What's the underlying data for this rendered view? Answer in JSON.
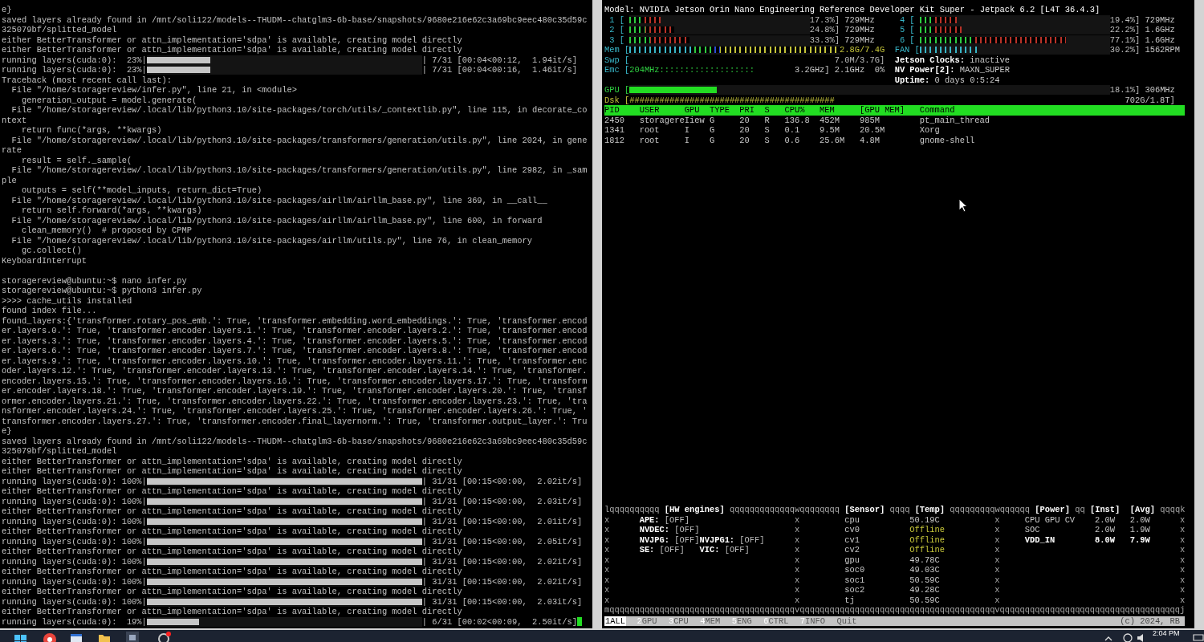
{
  "terminal": {
    "cursor": true,
    "lines": [
      {
        "kind": "text",
        "text": "e}"
      },
      {
        "kind": "text",
        "text": "saved layers already found in /mnt/soli122/models--THUDM--chatglm3-6b-base/snapshots/9680e216e62c3a69bc9eec480c35d59c"
      },
      {
        "kind": "text",
        "text": "325079bf/splitted_model"
      },
      {
        "kind": "text",
        "text": "either BetterTransformer or attn_implementation='sdpa' is available, creating model directly"
      },
      {
        "kind": "text",
        "text": "either BetterTransformer or attn_implementation='sdpa' is available, creating model directly"
      },
      {
        "kind": "progress",
        "prefix": "running layers(cuda:0):  23%|",
        "level": 0.23,
        "suffix": "| 7/31 [00:04<00:12,  1.94it/s]"
      },
      {
        "kind": "progress",
        "prefix": "running layers(cuda:0):  23%|",
        "level": 0.23,
        "suffix": "| 7/31 [00:04<00:16,  1.46it/s]"
      },
      {
        "kind": "text",
        "text": "Traceback (most recent call last):"
      },
      {
        "kind": "text",
        "text": "  File \"/home/storagereview/infer.py\", line 21, in <module>"
      },
      {
        "kind": "text",
        "text": "    generation_output = model.generate("
      },
      {
        "kind": "text",
        "text": "  File \"/home/storagereview/.local/lib/python3.10/site-packages/torch/utils/_contextlib.py\", line 115, in decorate_co"
      },
      {
        "kind": "text",
        "text": "ntext"
      },
      {
        "kind": "text",
        "text": "    return func(*args, **kwargs)"
      },
      {
        "kind": "text",
        "text": "  File \"/home/storagereview/.local/lib/python3.10/site-packages/transformers/generation/utils.py\", line 2024, in gene"
      },
      {
        "kind": "text",
        "text": "rate"
      },
      {
        "kind": "text",
        "text": "    result = self._sample("
      },
      {
        "kind": "text",
        "text": "  File \"/home/storagereview/.local/lib/python3.10/site-packages/transformers/generation/utils.py\", line 2982, in _sam"
      },
      {
        "kind": "text",
        "text": "ple"
      },
      {
        "kind": "text",
        "text": "    outputs = self(**model_inputs, return_dict=True)"
      },
      {
        "kind": "text",
        "text": "  File \"/home/storagereview/.local/lib/python3.10/site-packages/airllm/airllm_base.py\", line 369, in __call__"
      },
      {
        "kind": "text",
        "text": "    return self.forward(*args, **kwargs)"
      },
      {
        "kind": "text",
        "text": "  File \"/home/storagereview/.local/lib/python3.10/site-packages/airllm/airllm_base.py\", line 600, in forward"
      },
      {
        "kind": "text",
        "text": "    clean_memory()  # proposed by CPMP"
      },
      {
        "kind": "text",
        "text": "  File \"/home/storagereview/.local/lib/python3.10/site-packages/airllm/utils.py\", line 76, in clean_memory"
      },
      {
        "kind": "text",
        "text": "    gc.collect()"
      },
      {
        "kind": "text",
        "text": "KeyboardInterrupt"
      },
      {
        "kind": "blank"
      },
      {
        "kind": "text",
        "text": "storagereview@ubuntu:~$ nano infer.py"
      },
      {
        "kind": "text",
        "text": "storagereview@ubuntu:~$ python3 infer.py"
      },
      {
        "kind": "text",
        "text": ">>>> cache_utils installed"
      },
      {
        "kind": "text",
        "text": "found index file..."
      },
      {
        "kind": "text",
        "text": "found_layers:{'transformer.rotary_pos_emb.': True, 'transformer.embedding.word_embeddings.': True, 'transformer.encod"
      },
      {
        "kind": "text",
        "text": "er.layers.0.': True, 'transformer.encoder.layers.1.': True, 'transformer.encoder.layers.2.': True, 'transformer.encod"
      },
      {
        "kind": "text",
        "text": "er.layers.3.': True, 'transformer.encoder.layers.4.': True, 'transformer.encoder.layers.5.': True, 'transformer.encod"
      },
      {
        "kind": "text",
        "text": "er.layers.6.': True, 'transformer.encoder.layers.7.': True, 'transformer.encoder.layers.8.': True, 'transformer.encod"
      },
      {
        "kind": "text",
        "text": "er.layers.9.': True, 'transformer.encoder.layers.10.': True, 'transformer.encoder.layers.11.': True, 'transformer.enc"
      },
      {
        "kind": "text",
        "text": "oder.layers.12.': True, 'transformer.encoder.layers.13.': True, 'transformer.encoder.layers.14.': True, 'transformer."
      },
      {
        "kind": "text",
        "text": "encoder.layers.15.': True, 'transformer.encoder.layers.16.': True, 'transformer.encoder.layers.17.': True, 'transform"
      },
      {
        "kind": "text",
        "text": "er.encoder.layers.18.': True, 'transformer.encoder.layers.19.': True, 'transformer.encoder.layers.20.': True, 'transf"
      },
      {
        "kind": "text",
        "text": "ormer.encoder.layers.21.': True, 'transformer.encoder.layers.22.': True, 'transformer.encoder.layers.23.': True, 'tra"
      },
      {
        "kind": "text",
        "text": "nsformer.encoder.layers.24.': True, 'transformer.encoder.layers.25.': True, 'transformer.encoder.layers.26.': True, '"
      },
      {
        "kind": "text",
        "text": "transformer.encoder.layers.27.': True, 'transformer.encoder.final_layernorm.': True, 'transformer.output_layer.': Tru"
      },
      {
        "kind": "text",
        "text": "e}"
      },
      {
        "kind": "text",
        "text": "saved layers already found in /mnt/soli122/models--THUDM--chatglm3-6b-base/snapshots/9680e216e62c3a69bc9eec480c35d59c"
      },
      {
        "kind": "text",
        "text": "325079bf/splitted_model"
      },
      {
        "kind": "text",
        "text": "either BetterTransformer or attn_implementation='sdpa' is available, creating model directly"
      },
      {
        "kind": "text",
        "text": "either BetterTransformer or attn_implementation='sdpa' is available, creating model directly"
      },
      {
        "kind": "progress",
        "prefix": "running layers(cuda:0): 100%|",
        "level": 1,
        "suffix": "| 31/31 [00:15<00:00,  2.02it/s]"
      },
      {
        "kind": "text",
        "text": "either BetterTransformer or attn_implementation='sdpa' is available, creating model directly"
      },
      {
        "kind": "progress",
        "prefix": "running layers(cuda:0): 100%|",
        "level": 1,
        "suffix": "| 31/31 [00:15<00:00,  2.03it/s]"
      },
      {
        "kind": "text",
        "text": "either BetterTransformer or attn_implementation='sdpa' is available, creating model directly"
      },
      {
        "kind": "progress",
        "prefix": "running layers(cuda:0): 100%|",
        "level": 1,
        "suffix": "| 31/31 [00:15<00:00,  2.01it/s]"
      },
      {
        "kind": "text",
        "text": "either BetterTransformer or attn_implementation='sdpa' is available, creating model directly"
      },
      {
        "kind": "progress",
        "prefix": "running layers(cuda:0): 100%|",
        "level": 1,
        "suffix": "| 31/31 [00:15<00:00,  2.05it/s]"
      },
      {
        "kind": "text",
        "text": "either BetterTransformer or attn_implementation='sdpa' is available, creating model directly"
      },
      {
        "kind": "progress",
        "prefix": "running layers(cuda:0): 100%|",
        "level": 1,
        "suffix": "| 31/31 [00:15<00:00,  2.02it/s]"
      },
      {
        "kind": "text",
        "text": "either BetterTransformer or attn_implementation='sdpa' is available, creating model directly"
      },
      {
        "kind": "progress",
        "prefix": "running layers(cuda:0): 100%|",
        "level": 1,
        "suffix": "| 31/31 [00:15<00:00,  2.02it/s]"
      },
      {
        "kind": "text",
        "text": "either BetterTransformer or attn_implementation='sdpa' is available, creating model directly"
      },
      {
        "kind": "progress",
        "prefix": "running layers(cuda:0): 100%|",
        "level": 1,
        "suffix": "| 31/31 [00:15<00:00,  2.03it/s]"
      },
      {
        "kind": "text",
        "text": "either BetterTransformer or attn_implementation='sdpa' is available, creating model directly"
      },
      {
        "kind": "progress",
        "prefix": "running layers(cuda:0):  19%|",
        "level": 0.19,
        "suffix": "| 6/31 [00:02<00:09,  2.50it/s]"
      }
    ]
  },
  "monitor": {
    "model": "Model: NVIDIA Jetson Orin Nano Engineering Reference Developer Kit Super - Jetpack 6.2 [L4T 36.4.3]",
    "cpus": [
      {
        "label": "1 [",
        "level": 0.173,
        "reading": "17.3%]",
        "freq": "729MHz"
      },
      {
        "label": "4 [",
        "level": 0.194,
        "reading": "19.4%]",
        "freq": "729MHz"
      },
      {
        "label": "2 [",
        "level": 0.248,
        "reading": "24.8%]",
        "freq": "729MHz"
      },
      {
        "label": "5 [",
        "level": 0.222,
        "reading": "22.2%]",
        "freq": "1.6GHz"
      },
      {
        "label": "3 [",
        "level": 0.333,
        "reading": "33.3%]",
        "freq": "729MHz"
      },
      {
        "label": "6 [",
        "level": 0.771,
        "reading": "77.1%]",
        "freq": "1.6GHz"
      }
    ],
    "memory": {
      "label": "Mem [",
      "level": 1,
      "reading": "2.8G/7.4G"
    },
    "fan": {
      "label": "FAN [",
      "level": 0.302,
      "reading": "30.2%]",
      "speed": "1562RPM"
    },
    "swap": {
      "label": "Swp [",
      "reading": "7.0M/3.7G]"
    },
    "emc": {
      "label": "Emc [",
      "value": "204MHz:::::::::::::::::::",
      "reading": "3.2GHz]",
      "freq": "2.1GHz",
      "load": "0%"
    },
    "info": [
      {
        "label": "Jetson Clocks:",
        "value": "inactive"
      },
      {
        "label": "NV Power[2]:",
        "value": "MAXN_SUPER"
      },
      {
        "label": "Uptime:",
        "value": "0 days 0:5:24"
      }
    ],
    "gpu": {
      "label": "GPU [",
      "level": 0.181,
      "reading": "18.1%]",
      "freq": "306MHz"
    },
    "disk": {
      "label": "Dsk [",
      "value": "#########################################",
      "reading": "702G/1.8T]"
    },
    "processes": {
      "columns": [
        "PID",
        "USER",
        "GPU",
        "TYPE",
        "PRI",
        "S",
        "CPU%",
        "MEM",
        "[GPU MEM]",
        "Command"
      ],
      "rows": [
        [
          "2450",
          "storagere",
          "Iiew",
          "G",
          "20",
          "R",
          "136.8",
          "452M",
          "985M",
          "pt_main_thread"
        ],
        [
          "1341",
          "root",
          "I",
          "G",
          "20",
          "S",
          "0.1",
          "9.5M",
          "20.5M",
          "Xorg"
        ],
        [
          "1812",
          "root",
          "I",
          "G",
          "20",
          "S",
          "0.6",
          "25.6M",
          "4.8M",
          "gnome-shell"
        ]
      ]
    },
    "panel": {
      "top_border": [
        {
          "kind": "line",
          "text": "lqqqqqqqqqq "
        },
        {
          "kind": "title",
          "text": "[HW engines]"
        },
        {
          "kind": "line",
          "text": " qqqqqqqqqqqqqwqqqqqqqq "
        },
        {
          "kind": "title",
          "text": "[Sensor]"
        },
        {
          "kind": "line",
          "text": " qqqq "
        },
        {
          "kind": "title",
          "text": "[Temp]"
        },
        {
          "kind": "line",
          "text": " qqqqqqqqqwqqqqqq "
        },
        {
          "kind": "title",
          "text": "[Power]"
        },
        {
          "kind": "line",
          "text": " qq "
        },
        {
          "kind": "title",
          "text": "[Inst]"
        },
        {
          "kind": "title",
          "text": "[Avg]"
        },
        {
          "kind": "line",
          "text": " qqqqk"
        }
      ],
      "rows": [
        {
          "edges": [
            "x",
            "x",
            "x",
            "x"
          ],
          "engines": [
            {
              "name": "APE:",
              "state": "[OFF]"
            }
          ],
          "sensor": {
            "name": "cpu",
            "temp": "50.19C",
            "offline": false
          },
          "power": {
            "name": "CPU GPU CV",
            "inst": "2.0W",
            "avg": "2.0W",
            "total": false
          }
        },
        {
          "edges": [
            "x",
            "x",
            "x",
            "x"
          ],
          "engines": [
            {
              "name": "NVDEC:",
              "state": "[OFF]"
            }
          ],
          "sensor": {
            "name": "cv0",
            "temp": "Offline",
            "offline": true
          },
          "power": {
            "name": "SOC",
            "inst": "2.0W",
            "avg": "1.9W",
            "total": false
          }
        },
        {
          "edges": [
            "x",
            "x",
            "x",
            "x"
          ],
          "engines": [
            {
              "name": "NVJPG:",
              "state": "[OFF]"
            },
            {
              "name": "NVJPG1:",
              "state": "[OFF]"
            }
          ],
          "sensor": {
            "name": "cv1",
            "temp": "Offline",
            "offline": true
          },
          "power": {
            "name": "VDD_IN",
            "inst": "8.0W",
            "avg": "7.9W",
            "total": true
          }
        },
        {
          "edges": [
            "x",
            "x",
            "x",
            "x"
          ],
          "engines": [
            {
              "name": "SE:",
              "state": "[OFF]"
            },
            {
              "name": "VIC:",
              "state": "[OFF]"
            }
          ],
          "sensor": {
            "name": "cv2",
            "temp": "Offline",
            "offline": true
          }
        },
        {
          "edges": [
            "x",
            "x",
            "x",
            "x"
          ],
          "sensor": {
            "name": "gpu",
            "temp": "49.78C",
            "offline": false
          }
        },
        {
          "edges": [
            "x",
            "x",
            "x",
            "x"
          ],
          "sensor": {
            "name": "soc0",
            "temp": "49.03C",
            "offline": false
          }
        },
        {
          "edges": [
            "x",
            "x",
            "x",
            "x"
          ],
          "sensor": {
            "name": "soc1",
            "temp": "50.59C",
            "offline": false
          }
        },
        {
          "edges": [
            "x",
            "x",
            "x",
            "x"
          ],
          "sensor": {
            "name": "soc2",
            "temp": "49.28C",
            "offline": false
          }
        },
        {
          "edges": [
            "x",
            "x",
            "x",
            "x"
          ],
          "sensor": {
            "name": "tj",
            "temp": "50.59C",
            "offline": false
          }
        }
      ],
      "bottom_border": "mqqqqqqqqqqqqqqqqqqqqqqqqqqqqqqqqqqqqqvqqqqqqqqqqqqqqqqqqqqqqqqqqqqqqqqqqqqqqqvqqqqqqqqqqqqqqqqqqqqqqqqqqqqqqqqqqqqj"
    },
    "footer": {
      "tabs": [
        {
          "key": "1",
          "label": "ALL",
          "selected": true
        },
        {
          "key": "2",
          "label": "GPU",
          "selected": false
        },
        {
          "key": "3",
          "label": "CPU",
          "selected": false
        },
        {
          "key": "4",
          "label": "MEM",
          "selected": false
        },
        {
          "key": "5",
          "label": "ENG",
          "selected": false
        },
        {
          "key": "6",
          "label": "CTRL",
          "selected": false
        },
        {
          "key": "7",
          "label": "INFO",
          "selected": false
        },
        {
          "label": "Quit",
          "selected": false
        }
      ],
      "copyright": "(c) 2024, RB"
    }
  },
  "taskbar": {
    "time": "2:04 PM"
  }
}
